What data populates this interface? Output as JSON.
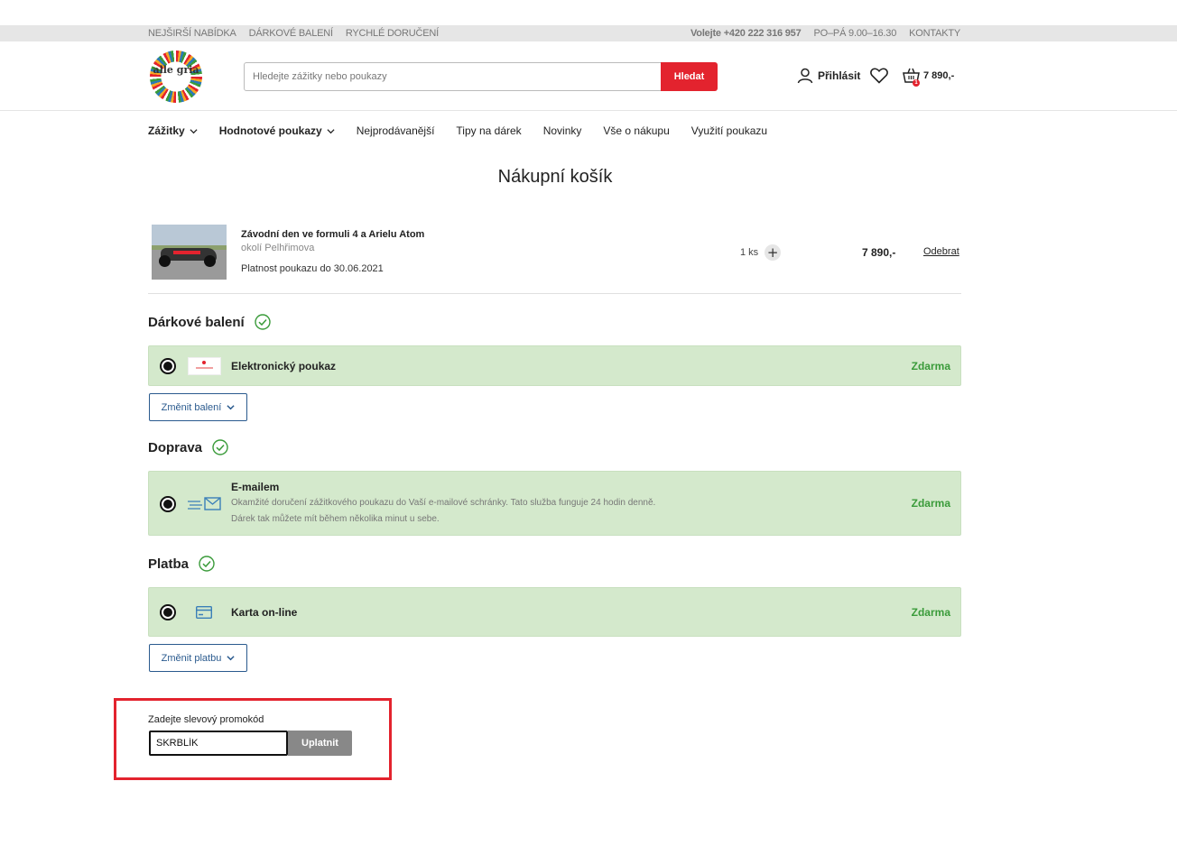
{
  "topbar": {
    "links": [
      "NEJŠIRŠÍ NABÍDKA",
      "DÁRKOVÉ BALENÍ",
      "RYCHLÉ DORUČENÍ"
    ],
    "phone_prefix": "Volejte",
    "phone": "+420 222 316 957",
    "hours": "PO–PÁ 9.00–16.30",
    "contacts": "KONTAKTY"
  },
  "header": {
    "logo_text": "alle gria",
    "search_placeholder": "Hledejte zážitky nebo poukazy",
    "search_button": "Hledat",
    "login": "Přihlásit",
    "cart_total": "7 890,-",
    "cart_count": "1"
  },
  "nav": {
    "items": [
      "Zážitky",
      "Hodnotové poukazy",
      "Nejprodávanější",
      "Tipy na dárek",
      "Novinky",
      "Vše o nákupu",
      "Využití poukazu"
    ]
  },
  "page_title": "Nákupní košík",
  "product": {
    "title": "Závodní den ve formuli 4 a Arielu Atom",
    "location": "okolí Pelhřimova",
    "validity": "Platnost poukazu do 30.06.2021",
    "quantity": "1 ks",
    "plus": "+",
    "price": "7 890,-",
    "remove": "Odebrat"
  },
  "gift_wrap": {
    "heading": "Dárkové balení",
    "option_label": "Elektronický poukaz",
    "option_price": "Zdarma",
    "change_button": "Změnit balení"
  },
  "delivery": {
    "heading": "Doprava",
    "option_label": "E-mailem",
    "description_line1": "Okamžité doručení zážitkového poukazu do Vaší e-mailové schránky. Tato služba funguje 24 hodin denně.",
    "description_line2": "Dárek tak můžete mít během několika minut u sebe.",
    "option_price": "Zdarma"
  },
  "payment": {
    "heading": "Platba",
    "option_label": "Karta on-line",
    "option_price": "Zdarma",
    "change_button": "Změnit platbu"
  },
  "promo": {
    "label": "Zadejte slevový promokód",
    "value": "SKRBLÍK",
    "button": "Uplatnit"
  },
  "colors": {
    "brand_red": "#e3232e",
    "option_bg": "#d4e9cc",
    "free_green": "#3a9b3a",
    "button_blue": "#2a5a8e"
  }
}
